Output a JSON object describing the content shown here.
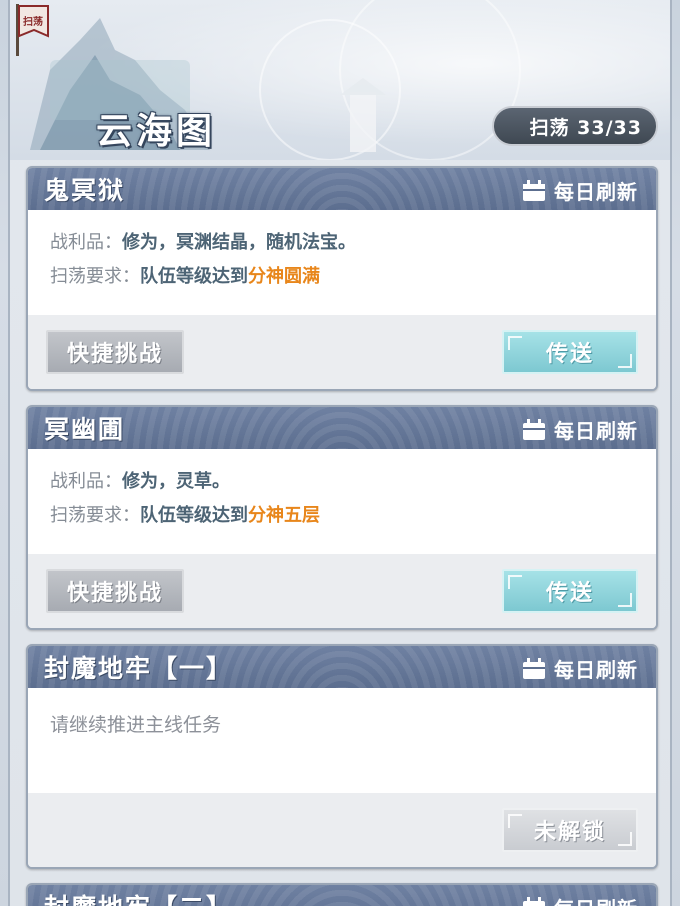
{
  "header": {
    "title": "云海图",
    "sweep_label": "扫荡 33/33",
    "flag_text": "扫荡"
  },
  "cards": [
    {
      "title": "鬼冥狱",
      "refresh": "每日刷新",
      "loot_label": "战利品：",
      "loot_value": "修为，冥渊结晶，随机法宝。",
      "req_label": "扫荡要求：",
      "req_prefix": "队伍等级达到",
      "req_highlight": "分神圆满",
      "quick_button": "快捷挑战",
      "action_button": "传送"
    },
    {
      "title": "冥幽圃",
      "refresh": "每日刷新",
      "loot_label": "战利品：",
      "loot_value": "修为，灵草。",
      "req_label": "扫荡要求：",
      "req_prefix": "队伍等级达到",
      "req_highlight": "分神五层",
      "quick_button": "快捷挑战",
      "action_button": "传送"
    },
    {
      "title": "封魔地牢【一】",
      "refresh": "每日刷新",
      "locked_message": "请继续推进主线任务",
      "action_button": "未解锁"
    },
    {
      "title": "封魔地牢【二】",
      "refresh": "每日刷新"
    }
  ],
  "colors": {
    "header_bar": "#5c6e8f",
    "highlight": "#e8861b",
    "teleport_button": "#7dc8d1"
  },
  "icons": [
    "calendar-icon",
    "sweep-flag-icon"
  ]
}
